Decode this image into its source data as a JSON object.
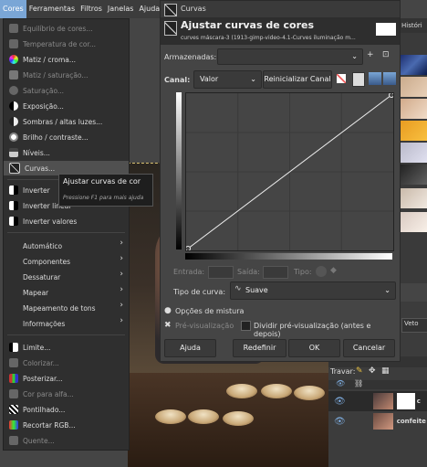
{
  "menubar": {
    "items": [
      "Cores",
      "Ferramentas",
      "Filtros",
      "Janelas",
      "Ajuda"
    ]
  },
  "menu": {
    "items": [
      {
        "label": "Equilíbrio de cores...",
        "enabled": false
      },
      {
        "label": "Temperatura de cor...",
        "enabled": false
      },
      {
        "label": "Matiz / croma...",
        "enabled": true
      },
      {
        "label": "Matiz / saturação...",
        "enabled": false
      },
      {
        "label": "Saturação...",
        "enabled": false
      },
      {
        "label": "Exposição...",
        "enabled": true
      },
      {
        "label": "Sombras / altas luzes...",
        "enabled": true
      },
      {
        "label": "Brilho / contraste...",
        "enabled": true
      },
      {
        "label": "Níveis...",
        "enabled": true
      },
      {
        "label": "Curvas...",
        "enabled": true,
        "highlighted": true
      },
      {
        "label": "Inverter",
        "enabled": true
      },
      {
        "label": "Inverter linear",
        "enabled": true
      },
      {
        "label": "Inverter valores",
        "enabled": true
      },
      {
        "label": "Automático",
        "enabled": true,
        "submenu": true
      },
      {
        "label": "Componentes",
        "enabled": true,
        "submenu": true
      },
      {
        "label": "Dessaturar",
        "enabled": true,
        "submenu": true
      },
      {
        "label": "Mapear",
        "enabled": true,
        "submenu": true
      },
      {
        "label": "Mapeamento de tons",
        "enabled": true,
        "submenu": true
      },
      {
        "label": "Informações",
        "enabled": true,
        "submenu": true
      },
      {
        "label": "Limite...",
        "enabled": true
      },
      {
        "label": "Colorizar...",
        "enabled": false
      },
      {
        "label": "Posterizar...",
        "enabled": true
      },
      {
        "label": "Cor para alfa...",
        "enabled": false
      },
      {
        "label": "Pontilhado...",
        "enabled": true
      },
      {
        "label": "Recortar RGB...",
        "enabled": true
      },
      {
        "label": "Quente...",
        "enabled": false
      }
    ]
  },
  "tooltip": {
    "title": "Ajustar curvas de cor",
    "hint": "Pressione F1 para mais ajuda"
  },
  "dialog": {
    "window_title": "Curvas",
    "heading": "Ajustar curvas de cores",
    "subheading": "curves máscara-3 (1913-gimp-video-4.1-Curves iluminação m...",
    "presets_label": "Armazenadas:",
    "presets_value": "",
    "channel_label": "Canal:",
    "channel_value": "Valor",
    "reset_channel": "Reinicializar Canal",
    "input_label": "Entrada:",
    "output_label": "Saída:",
    "type_label": "Tipo:",
    "curve_type_label": "Tipo de curva:",
    "curve_type_value": "Suave",
    "blend_options": "Opções de mistura",
    "preview_label": "Pré-visualização",
    "split_preview_label": "Dividir pré-visualização (antes e depois)",
    "buttons": {
      "help": "Ajuda",
      "reset": "Redefinir",
      "ok": "OK",
      "cancel": "Cancelar"
    }
  },
  "history_tab": "Históri",
  "layers": {
    "lock_label": "Travar:",
    "rows": [
      {
        "name": "c"
      },
      {
        "name": "confeite"
      }
    ],
    "tab_label": "Veto"
  },
  "colors": {
    "accent": "#7aa6d6",
    "menu_bg": "#2f2f2f",
    "dialog_bg": "#454545"
  }
}
